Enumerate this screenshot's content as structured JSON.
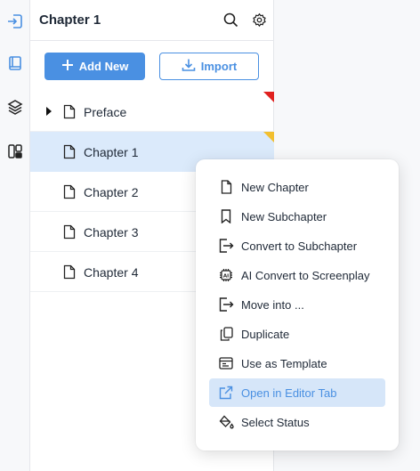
{
  "rail": {
    "icons": [
      "sign-in-icon",
      "book-icon",
      "layers-icon",
      "board-icon"
    ]
  },
  "panel": {
    "title": "Chapter 1",
    "add_new_label": "Add New",
    "import_label": "Import"
  },
  "tree": {
    "items": [
      {
        "label": "Preface",
        "expandable": true,
        "status_color": "#e0211f"
      },
      {
        "label": "Chapter 1",
        "selected": true,
        "status_color": "#f2bf2f"
      },
      {
        "label": "Chapter 2"
      },
      {
        "label": "Chapter 3"
      },
      {
        "label": "Chapter 4"
      }
    ]
  },
  "context_menu": {
    "items": [
      {
        "label": "New Chapter",
        "icon": "file-icon"
      },
      {
        "label": "New Subchapter",
        "icon": "bookmark-icon"
      },
      {
        "label": "Convert to Subchapter",
        "icon": "convert-icon"
      },
      {
        "label": "AI Convert to Screenplay",
        "icon": "ai-chip-icon"
      },
      {
        "label": "Move into ...",
        "icon": "move-icon"
      },
      {
        "label": "Duplicate",
        "icon": "duplicate-icon"
      },
      {
        "label": "Use as Template",
        "icon": "template-icon"
      },
      {
        "label": "Open in Editor Tab",
        "icon": "external-link-icon",
        "highlighted": true
      },
      {
        "label": "Select Status",
        "icon": "paint-bucket-icon"
      }
    ]
  },
  "colors": {
    "accent": "#4a90e2",
    "selected_row": "#dbeafb",
    "menu_hover": "#d6e6f9"
  }
}
